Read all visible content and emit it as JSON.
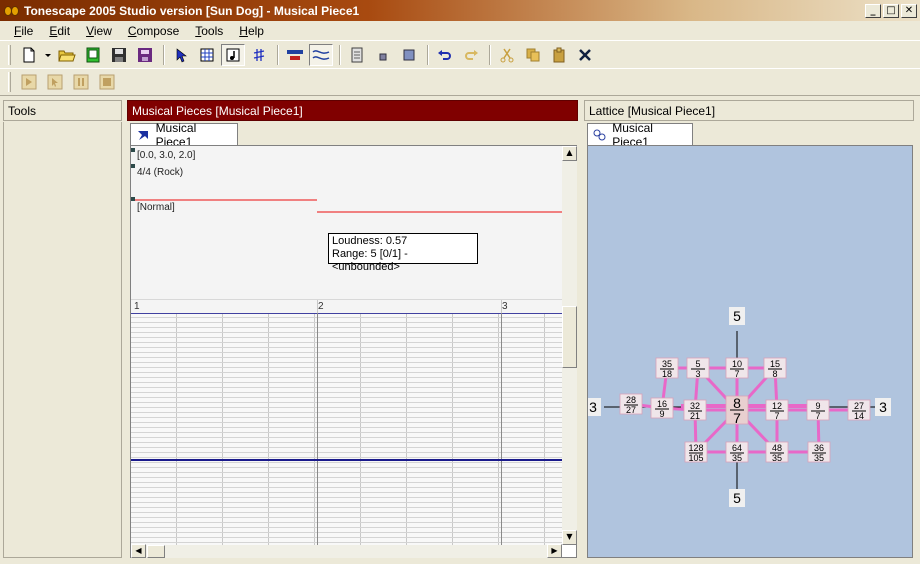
{
  "window": {
    "title": "Tonescape 2005 Studio  version [Sun Dog]  -  Musical Piece1",
    "minimize_glyph": "_",
    "maximize_glyph": "□",
    "close_glyph": "✕"
  },
  "menu": [
    {
      "label": "File",
      "key": "F",
      "rest": "ile"
    },
    {
      "label": "Edit",
      "key": "E",
      "rest": "dit"
    },
    {
      "label": "View",
      "key": "V",
      "rest": "iew"
    },
    {
      "label": "Compose",
      "key": "C",
      "rest": "ompose"
    },
    {
      "label": "Tools",
      "key": "T",
      "rest": "ools"
    },
    {
      "label": "Help",
      "key": "H",
      "rest": "elp"
    }
  ],
  "toolbar_icons": [
    "new-icon",
    "dropdown-arrow-icon",
    "open-folder-icon",
    "green-file-icon",
    "save-icon",
    "save-all-icon",
    "select-arrow-icon",
    "grid-icon",
    "note-icon",
    "sharp-icon",
    "align-icon",
    "wave-icon",
    "document-icon",
    "small-square-icon",
    "square-icon",
    "undo-icon",
    "redo-icon",
    "cut-icon",
    "copy-icon",
    "paste-icon",
    "delete-icon"
  ],
  "transport_icons": [
    "play-icon",
    "step-icon",
    "pause-icon",
    "stop-icon"
  ],
  "panes": {
    "tools": {
      "title": "Tools"
    },
    "musical_pieces": {
      "title": "Musical Pieces  [Musical Piece1]",
      "tab": "Musical Piece1"
    },
    "lattice": {
      "title": "Lattice  [Musical Piece1]",
      "tab": "Musical Piece1"
    }
  },
  "piece": {
    "tempo_label": "[0.0, 3.0, 2.0]",
    "meter_label": "4/4 (Rock)",
    "dynamics_label": "[Normal]",
    "tooltip_line1": "Loudness: 0.57",
    "tooltip_line2": "Range: 5 [0/1] - <unbounded>",
    "measures": [
      "1",
      "2",
      "3"
    ]
  },
  "lattice": {
    "axis_labels": {
      "top": "5",
      "bottom": "5",
      "left": "3",
      "right": "3"
    },
    "center": {
      "num": "8",
      "den": "7"
    },
    "nodes": [
      {
        "num": "35",
        "den": "18"
      },
      {
        "num": "5",
        "den": "3"
      },
      {
        "num": "10",
        "den": "7"
      },
      {
        "num": "15",
        "den": "8"
      },
      {
        "num": "28",
        "den": "27"
      },
      {
        "num": "16",
        "den": "9"
      },
      {
        "num": "32",
        "den": "21"
      },
      {
        "num": "12",
        "den": "7"
      },
      {
        "num": "9",
        "den": "7"
      },
      {
        "num": "27",
        "den": "14"
      },
      {
        "num": "128",
        "den": "105"
      },
      {
        "num": "64",
        "den": "35"
      },
      {
        "num": "48",
        "den": "35"
      },
      {
        "num": "36",
        "den": "35"
      }
    ]
  },
  "colors": {
    "title_gradient_start": "#7a2c00",
    "pane_header_active": "#800000",
    "lattice_bg": "#b0c4de",
    "lattice_edge": "#e868c8",
    "loudness_line": "#f08080",
    "playhead": "#1a1a8c"
  }
}
